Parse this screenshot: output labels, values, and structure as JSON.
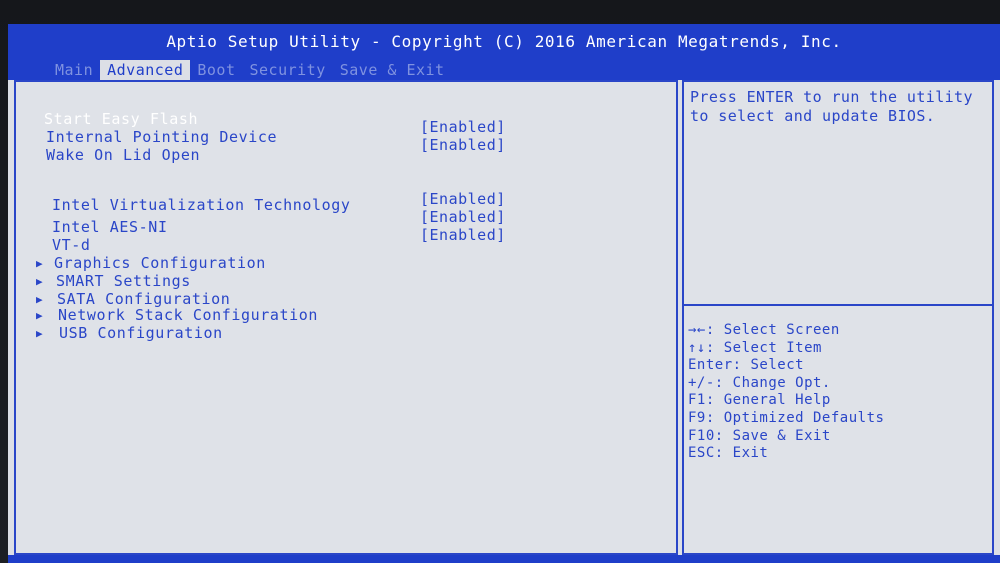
{
  "header": {
    "title": "Aptio Setup Utility - Copyright (C) 2016 American Megatrends, Inc.",
    "tabs": [
      {
        "label": "Main"
      },
      {
        "label": "Advanced"
      },
      {
        "label": "Boot"
      },
      {
        "label": "Security"
      },
      {
        "label": "Save & Exit"
      }
    ]
  },
  "menu": {
    "items": [
      {
        "label": "Start Easy Flash",
        "value": ""
      },
      {
        "label": "Internal Pointing Device",
        "value": "[Enabled]"
      },
      {
        "label": "Wake On Lid Open",
        "value": "[Enabled]"
      },
      {
        "label": "Intel Virtualization Technology",
        "value": "[Enabled]"
      },
      {
        "label": "Intel AES-NI",
        "value": "[Enabled]"
      },
      {
        "label": "VT-d",
        "value": "[Enabled]"
      },
      {
        "label": "Graphics Configuration",
        "value": ""
      },
      {
        "label": "SMART Settings",
        "value": ""
      },
      {
        "label": "SATA Configuration",
        "value": ""
      },
      {
        "label": "Network Stack Configuration",
        "value": ""
      },
      {
        "label": "USB Configuration",
        "value": ""
      }
    ]
  },
  "help": {
    "text": "Press ENTER to run the utility to select and update BIOS.",
    "keys": [
      "→←: Select Screen",
      "↑↓: Select Item",
      "Enter: Select",
      "+/-: Change Opt.",
      "F1: General Help",
      "F9: Optimized Defaults",
      "F10: Save & Exit",
      "ESC: Exit"
    ]
  }
}
